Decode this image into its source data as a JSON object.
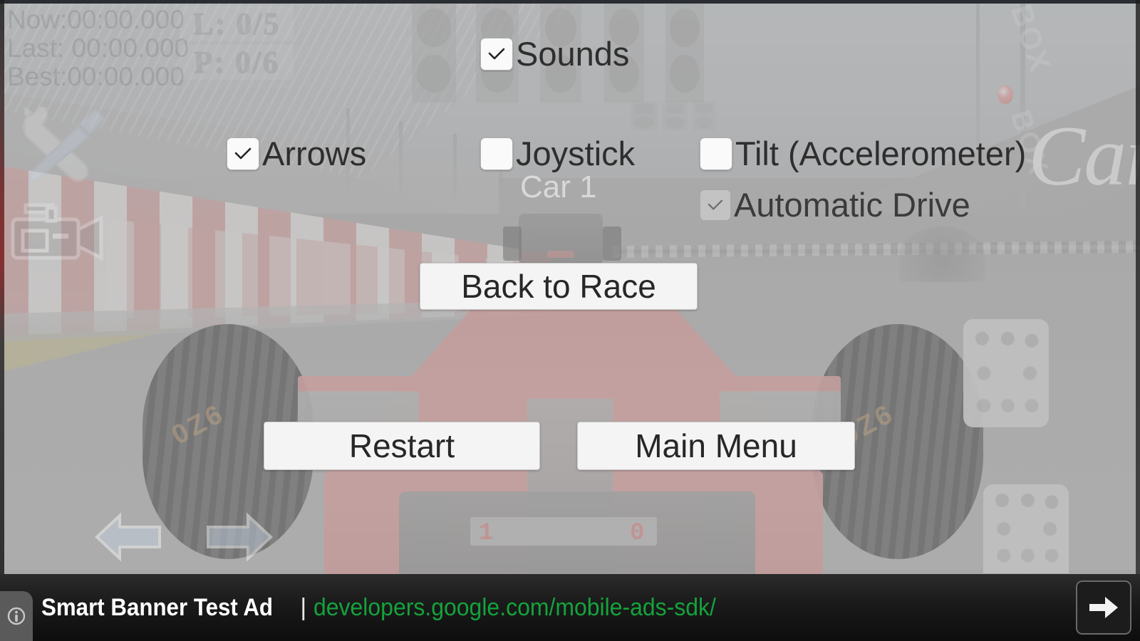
{
  "hud": {
    "timers": {
      "now_label": "Now:",
      "now_value": "00:00.000",
      "last_label": "Last:",
      "last_value": "00:00.000",
      "best_label": "Best:",
      "best_value": "00:00.000",
      "block": "Now:00:00.000\nLast: 00:00.000\nBest:00:00.000"
    },
    "laps_counter": "L: 0/5",
    "position_counter": "P: 0/6",
    "settings_icon": "wrench-screwdriver-icon",
    "camera_icon": "video-camera-icon",
    "steer_left_icon": "arrow-left-icon",
    "steer_right_icon": "arrow-right-icon",
    "car_label": "Car 1",
    "sign_text": "BOX",
    "big_word": "Car",
    "dash_left_digit": "1",
    "dash_right_digit": "0",
    "tyre_code": "0Z6"
  },
  "pause_menu": {
    "options": [
      {
        "id": "sounds",
        "label": "Sounds",
        "checked": true,
        "disabled": false
      },
      {
        "id": "arrows",
        "label": "Arrows",
        "checked": true,
        "disabled": false
      },
      {
        "id": "joystick",
        "label": "Joystick",
        "checked": false,
        "disabled": false
      },
      {
        "id": "tilt",
        "label": "Tilt (Accelerometer)",
        "checked": false,
        "disabled": false
      },
      {
        "id": "auto",
        "label": "Automatic Drive",
        "checked": true,
        "disabled": true
      }
    ],
    "buttons": {
      "back_to_race": "Back to Race",
      "restart": "Restart",
      "main_menu": "Main Menu"
    }
  },
  "ad_banner": {
    "title": "Smart Banner Test Ad",
    "separator": "|",
    "url": "developers.google.com/mobile-ads-sdk/",
    "info_icon": "info-circle-icon",
    "next_icon": "arrow-right-icon"
  },
  "colors": {
    "ad_background": "#111111",
    "ad_url_green": "#14a33c",
    "button_face": "#f4f4f4",
    "label_text": "#2e2e2e",
    "road_grey": "#acacac",
    "car_red": "#e28c8c"
  }
}
